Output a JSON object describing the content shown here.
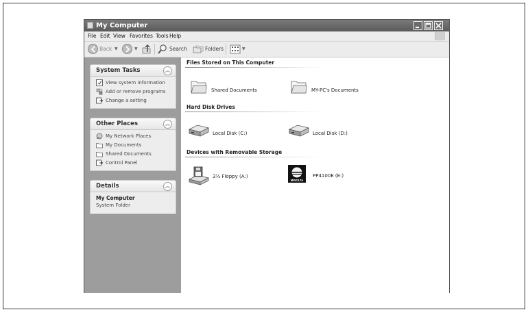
{
  "window": {
    "title": "My Computer",
    "controls": [
      "minimize",
      "maximize",
      "close"
    ]
  },
  "menubar": {
    "items": [
      "File",
      "Edit",
      "View",
      "Favorites",
      "Tools",
      "Help"
    ]
  },
  "toolbar": {
    "back_label": "Back",
    "search_label": "Search",
    "folders_label": "Folders"
  },
  "system_tasks": {
    "title": "System Tasks",
    "items": [
      {
        "label": "View system information",
        "icon": "info-icon"
      },
      {
        "label": "Add or remove programs",
        "icon": "programs-icon"
      },
      {
        "label": "Change a setting",
        "icon": "settings-icon"
      }
    ]
  },
  "other_places": {
    "title": "Other Places",
    "items": [
      {
        "label": "My Network Places",
        "icon": "network-icon"
      },
      {
        "label": "My Documents",
        "icon": "folder-icon"
      },
      {
        "label": "Shared Documents",
        "icon": "folder-icon"
      },
      {
        "label": "Control Panel",
        "icon": "control-panel-icon"
      }
    ]
  },
  "details": {
    "title": "Details",
    "name": "My Computer",
    "type": "System Folder"
  },
  "groups": [
    {
      "title": "Files Stored on This Computer",
      "items": [
        {
          "label": "Shared Documents",
          "icon": "folder-icon"
        },
        {
          "label": "MY-PC's Documents",
          "icon": "folder-icon"
        }
      ]
    },
    {
      "title": "Hard Disk Drives",
      "items": [
        {
          "label": "Local Disk (C:)",
          "icon": "hard-disk-icon"
        },
        {
          "label": "Local Disk (D:)",
          "icon": "hard-disk-icon"
        }
      ]
    },
    {
      "title": "Devices with Removable Storage",
      "items": [
        {
          "label": "3½ Floppy (A:)",
          "icon": "floppy-drive-icon"
        },
        {
          "label": "PP4100E (E:)",
          "icon": "minolta-drive-icon",
          "icon_text": "MINOLTA"
        }
      ]
    }
  ]
}
